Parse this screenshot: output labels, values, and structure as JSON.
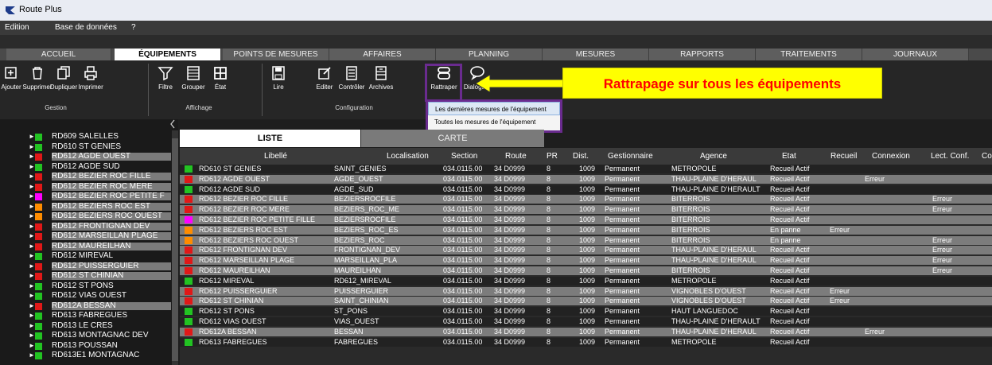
{
  "app": {
    "title": "Route Plus"
  },
  "menu": [
    "Edition",
    "Base de données",
    "?"
  ],
  "tabs": [
    "ACCUEIL",
    "ÉQUIPEMENTS",
    "POINTS DE MESURES",
    "AFFAIRES",
    "PLANNING",
    "MESURES",
    "RAPPORTS",
    "TRAITEMENTS",
    "JOURNAUX"
  ],
  "ribbon": {
    "buttons": [
      "Ajouter",
      "Supprimer",
      "Dupliquer",
      "Imprimer",
      "Filtre",
      "Grouper",
      "État",
      "Lire",
      "Editer",
      "Contrôler",
      "Archives",
      "Rattraper",
      "Dialoguer"
    ],
    "groups": [
      "Gestion",
      "Affichage",
      "Configuration"
    ]
  },
  "annotation": "Rattrapage sur tous les équipements",
  "dropdown": [
    "Les dernières mesures de l'équipement",
    "Toutes les mesures de l'équipement"
  ],
  "view_tabs": [
    "LISTE",
    "CARTE"
  ],
  "colors": {
    "green": "#22c322",
    "red": "#e01818",
    "orange": "#ff8c00",
    "magenta": "#ff00ff",
    "accent": "#6a2b8f"
  },
  "left_list": [
    {
      "name": "RD609 SALELLES",
      "status": "green"
    },
    {
      "name": "RD610 ST GENIES",
      "status": "green"
    },
    {
      "name": "RD612 AGDE OUEST",
      "status": "red"
    },
    {
      "name": "RD612 AGDE SUD",
      "status": "green"
    },
    {
      "name": "RD612 BEZIER ROC FILLE",
      "status": "red"
    },
    {
      "name": "RD612 BEZIER ROC MERE",
      "status": "red"
    },
    {
      "name": "RD612 BEZIER ROC PETITE F",
      "status": "magenta"
    },
    {
      "name": "RD612 BEZIERS ROC EST",
      "status": "orange"
    },
    {
      "name": "RD612 BEZIERS ROC OUEST",
      "status": "orange"
    },
    {
      "name": "RD612 FRONTIGNAN DEV",
      "status": "red"
    },
    {
      "name": "RD612 MARSEILLAN PLAGE",
      "status": "red"
    },
    {
      "name": "RD612 MAUREILHAN",
      "status": "red"
    },
    {
      "name": "RD612 MIREVAL",
      "status": "green"
    },
    {
      "name": "RD612 PUISSERGUIER",
      "status": "red"
    },
    {
      "name": "RD612 ST CHINIAN",
      "status": "red"
    },
    {
      "name": "RD612 ST PONS",
      "status": "green"
    },
    {
      "name": "RD612 VIAS OUEST",
      "status": "green"
    },
    {
      "name": "RD612A BESSAN",
      "status": "red"
    },
    {
      "name": "RD613 FABREGUES",
      "status": "green"
    },
    {
      "name": "RD613 LE CRES",
      "status": "green"
    },
    {
      "name": "RD613 MONTAGNAC DEV",
      "status": "green"
    },
    {
      "name": "RD613 POUSSAN",
      "status": "green"
    },
    {
      "name": "RD613E1 MONTAGNAC",
      "status": "green"
    }
  ],
  "grid": {
    "headers": [
      "Libellé",
      "Localisation",
      "Section",
      "Route",
      "PR",
      "Dist.",
      "Gestionnaire",
      "Agence",
      "Etat",
      "Recueil",
      "Connexion",
      "Lect. Conf.",
      "Con"
    ],
    "rows": [
      {
        "status": "green",
        "lib": "RD610 ST GENIES",
        "loc": "SAINT_GENIES",
        "sec": "034.0115.00",
        "route": "34 D0999",
        "pr": "8",
        "dist": "1009",
        "gest": "Permanent",
        "agence": "METROPOLE",
        "etat": "Recueil Actif",
        "recueil": "",
        "connexion": "",
        "lect": ""
      },
      {
        "status": "red",
        "lib": "RD612 AGDE OUEST",
        "loc": "AGDE_OUEST",
        "sec": "034.0115.00",
        "route": "34 D0999",
        "pr": "8",
        "dist": "1009",
        "gest": "Permanent",
        "agence": "THAU-PLAINE D'HERAUL",
        "etat": "Recueil Actif",
        "recueil": "",
        "connexion": "Erreur",
        "lect": ""
      },
      {
        "status": "green",
        "lib": "RD612 AGDE SUD",
        "loc": "AGDE_SUD",
        "sec": "034.0115.00",
        "route": "34 D0999",
        "pr": "8",
        "dist": "1009",
        "gest": "Permanent",
        "agence": "THAU-PLAINE D'HERAULT",
        "etat": "Recueil Actif",
        "recueil": "",
        "connexion": "",
        "lect": ""
      },
      {
        "status": "red",
        "lib": "RD612 BEZIER ROC FILLE",
        "loc": "BEZIERSROCFILE",
        "sec": "034.0115.00",
        "route": "34 D0999",
        "pr": "8",
        "dist": "1009",
        "gest": "Permanent",
        "agence": "BITERROIS",
        "etat": "Recueil Actif",
        "recueil": "",
        "connexion": "",
        "lect": "Erreur"
      },
      {
        "status": "red",
        "lib": "RD612 BEZIER ROC MERE",
        "loc": "BEZIERS_ROC_ME",
        "sec": "034.0115.00",
        "route": "34 D0999",
        "pr": "8",
        "dist": "1009",
        "gest": "Permanent",
        "agence": "BITERROIS",
        "etat": "Recueil Actif",
        "recueil": "",
        "connexion": "",
        "lect": "Erreur"
      },
      {
        "status": "magenta",
        "lib": "RD612 BEZIER ROC PETITE FILLE",
        "loc": "BEZIERSROCFILE",
        "sec": "034.0115.00",
        "route": "34 D0999",
        "pr": "8",
        "dist": "1009",
        "gest": "Permanent",
        "agence": "BITERROIS",
        "etat": "Recueil Actif",
        "recueil": "",
        "connexion": "",
        "lect": ""
      },
      {
        "status": "orange",
        "lib": "RD612 BEZIERS ROC EST",
        "loc": "BEZIERS_ROC_ES",
        "sec": "034.0115.00",
        "route": "34 D0999",
        "pr": "8",
        "dist": "1009",
        "gest": "Permanent",
        "agence": "BITERROIS",
        "etat": "En panne",
        "recueil": "Erreur",
        "connexion": "",
        "lect": ""
      },
      {
        "status": "orange",
        "lib": "RD612 BEZIERS ROC OUEST",
        "loc": "BEZIERS_ROC",
        "sec": "034.0115.00",
        "route": "34 D0999",
        "pr": "8",
        "dist": "1009",
        "gest": "Permanent",
        "agence": "BITERROIS",
        "etat": "En panne",
        "recueil": "",
        "connexion": "",
        "lect": "Erreur"
      },
      {
        "status": "red",
        "lib": "RD612 FRONTIGNAN DEV",
        "loc": "FRONTIGNAN_DEV",
        "sec": "034.0115.00",
        "route": "34 D0999",
        "pr": "8",
        "dist": "1009",
        "gest": "Permanent",
        "agence": "THAU-PLAINE D'HERAUL",
        "etat": "Recueil Actif",
        "recueil": "",
        "connexion": "",
        "lect": "Erreur"
      },
      {
        "status": "red",
        "lib": "RD612 MARSEILLAN PLAGE",
        "loc": "MARSEILLAN_PLA",
        "sec": "034.0115.00",
        "route": "34 D0999",
        "pr": "8",
        "dist": "1009",
        "gest": "Permanent",
        "agence": "THAU-PLAINE D'HERAUL",
        "etat": "Recueil Actif",
        "recueil": "",
        "connexion": "",
        "lect": "Erreur"
      },
      {
        "status": "red",
        "lib": "RD612 MAUREILHAN",
        "loc": "MAUREILHAN",
        "sec": "034.0115.00",
        "route": "34 D0999",
        "pr": "8",
        "dist": "1009",
        "gest": "Permanent",
        "agence": "BITERROIS",
        "etat": "Recueil Actif",
        "recueil": "",
        "connexion": "",
        "lect": "Erreur"
      },
      {
        "status": "green",
        "lib": "RD612 MIREVAL",
        "loc": "RD612_MIREVAL",
        "sec": "034.0115.00",
        "route": "34 D0999",
        "pr": "8",
        "dist": "1009",
        "gest": "Permanent",
        "agence": "METROPOLE",
        "etat": "Recueil Actif",
        "recueil": "",
        "connexion": "",
        "lect": ""
      },
      {
        "status": "red",
        "lib": "RD612 PUISSERGUIER",
        "loc": "PUISSERGUIER",
        "sec": "034.0115.00",
        "route": "34 D0999",
        "pr": "8",
        "dist": "1009",
        "gest": "Permanent",
        "agence": "VIGNOBLES D'OUEST",
        "etat": "Recueil Actif",
        "recueil": "Erreur",
        "connexion": "",
        "lect": ""
      },
      {
        "status": "red",
        "lib": "RD612 ST CHINIAN",
        "loc": "SAINT_CHINIAN",
        "sec": "034.0115.00",
        "route": "34 D0999",
        "pr": "8",
        "dist": "1009",
        "gest": "Permanent",
        "agence": "VIGNOBLES D'OUEST",
        "etat": "Recueil Actif",
        "recueil": "Erreur",
        "connexion": "",
        "lect": ""
      },
      {
        "status": "green",
        "lib": "RD612 ST PONS",
        "loc": "ST_PONS",
        "sec": "034.0115.00",
        "route": "34 D0999",
        "pr": "8",
        "dist": "1009",
        "gest": "Permanent",
        "agence": "HAUT LANGUEDOC",
        "etat": "Recueil Actif",
        "recueil": "",
        "connexion": "",
        "lect": ""
      },
      {
        "status": "green",
        "lib": "RD612 VIAS OUEST",
        "loc": "VIAS_OUEST",
        "sec": "034.0115.00",
        "route": "34 D0999",
        "pr": "8",
        "dist": "1009",
        "gest": "Permanent",
        "agence": "THAU-PLAINE D'HERAULT",
        "etat": "Recueil Actif",
        "recueil": "",
        "connexion": "",
        "lect": ""
      },
      {
        "status": "red",
        "lib": "RD612A BESSAN",
        "loc": "BESSAN",
        "sec": "034.0115.00",
        "route": "34 D0999",
        "pr": "8",
        "dist": "1009",
        "gest": "Permanent",
        "agence": "THAU-PLAINE D'HERAUL",
        "etat": "Recueil Actif",
        "recueil": "",
        "connexion": "Erreur",
        "lect": ""
      },
      {
        "status": "green",
        "lib": "RD613 FABREGUES",
        "loc": "FABREGUES",
        "sec": "034.0115.00",
        "route": "34 D0999",
        "pr": "8",
        "dist": "1009",
        "gest": "Permanent",
        "agence": "METROPOLE",
        "etat": "Recueil Actif",
        "recueil": "",
        "connexion": "",
        "lect": ""
      }
    ]
  }
}
